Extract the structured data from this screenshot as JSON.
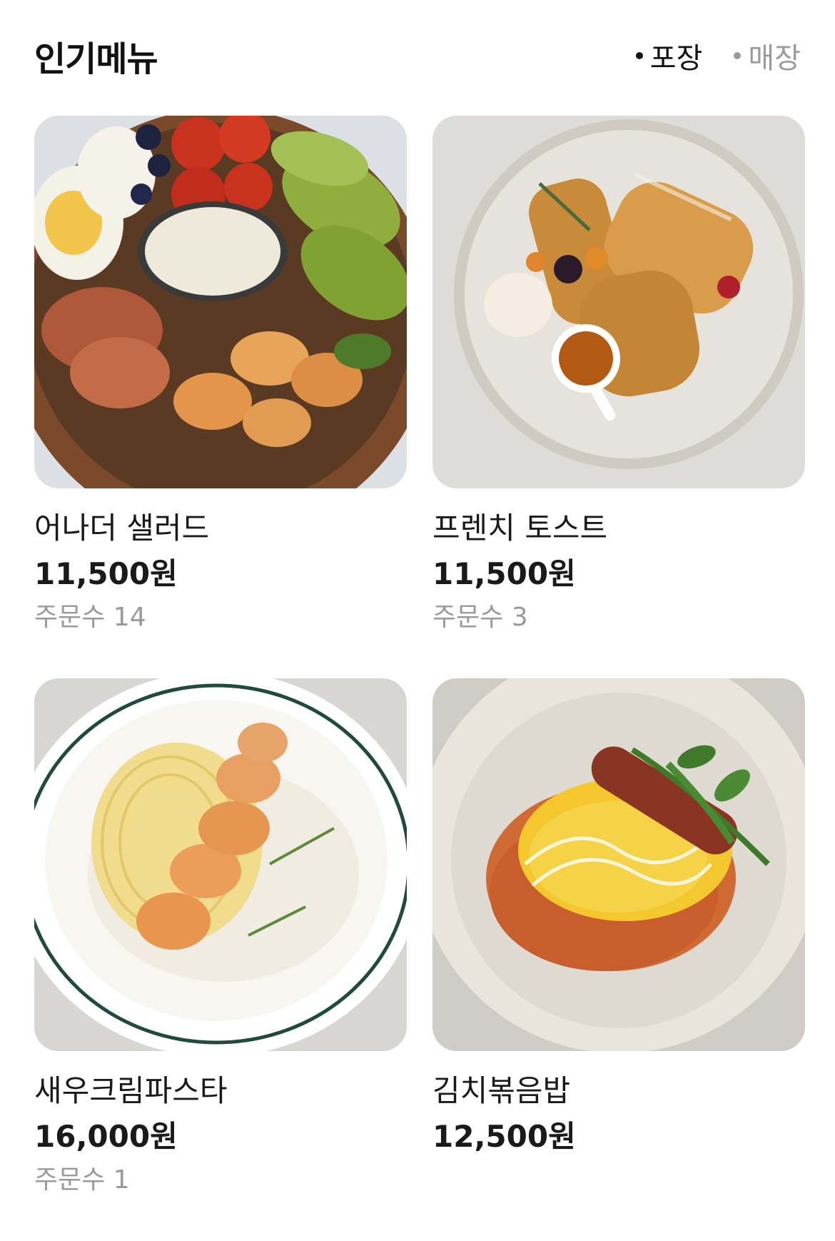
{
  "header": {
    "title": "인기메뉴",
    "toggle": [
      {
        "label": "포장",
        "active": true
      },
      {
        "label": "매장",
        "active": false
      }
    ]
  },
  "menu": [
    {
      "name": "어나더 샐러드",
      "price": "11,500원",
      "orders": "주문수 14",
      "image_icon": "salad-bowl-photo"
    },
    {
      "name": "프렌치 토스트",
      "price": "11,500원",
      "orders": "주문수 3",
      "image_icon": "french-toast-photo"
    },
    {
      "name": "새우크림파스타",
      "price": "16,000원",
      "orders": "주문수 1",
      "image_icon": "shrimp-cream-pasta-photo"
    },
    {
      "name": "김치볶음밥",
      "price": "12,500원",
      "orders": "",
      "image_icon": "kimchi-fried-rice-photo"
    }
  ],
  "colors": {
    "text_primary": "#111111",
    "text_secondary": "#9a9a9a",
    "background": "#ffffff"
  }
}
